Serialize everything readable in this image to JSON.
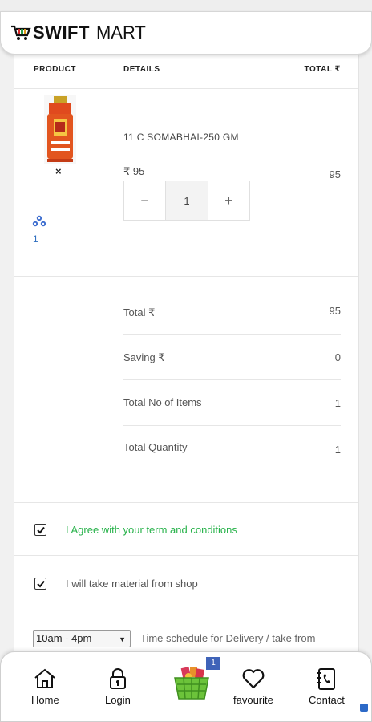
{
  "header": {
    "brand_bold": "SWIFT",
    "brand_regular": "MART"
  },
  "table": {
    "columns": {
      "product": "PRODUCT",
      "details": "DETAILS",
      "total": "TOTAL ₹"
    },
    "item": {
      "name": "11 C SOMABHAI-250 GM",
      "price": "₹ 95",
      "quantity": "1",
      "line_total": "95",
      "remove_symbol": "×",
      "share_count": "1"
    },
    "stepper": {
      "minus": "−",
      "plus": "+"
    }
  },
  "summary": [
    {
      "label": "Total ₹",
      "value": "95"
    },
    {
      "label": "Saving ₹",
      "value": "0"
    },
    {
      "label": "Total No of Items",
      "value": "1"
    },
    {
      "label": "Total Quantity",
      "value": "1"
    }
  ],
  "options": {
    "agree": {
      "label": "I Agree with your term and conditions",
      "checked": true
    },
    "pickup": {
      "label": "I will take material from shop",
      "checked": true
    }
  },
  "schedule": {
    "selected": "10am - 4pm",
    "label": "Time schedule for Delivery / take from"
  },
  "bottom_nav": {
    "home": "Home",
    "login": "Login",
    "cart_badge": "1",
    "favourite": "favourite",
    "contact": "Contact"
  },
  "colors": {
    "agree_green": "#27b24a",
    "badge_blue": "#3f63b8",
    "link_blue": "#2f6fc0"
  }
}
